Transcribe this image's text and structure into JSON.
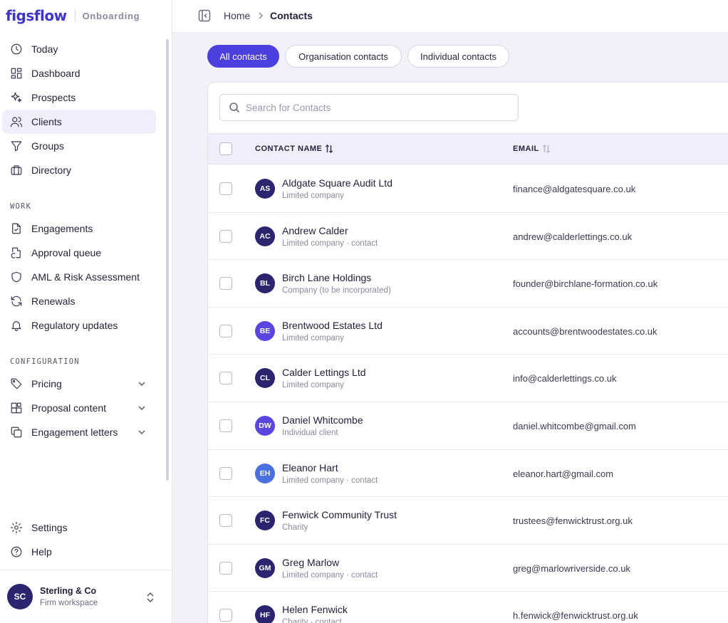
{
  "brand": {
    "logo": "figsflow",
    "workspace_label": "Onboarding"
  },
  "sidebar": {
    "top_items": [
      {
        "label": "Today",
        "icon": "clock-icon"
      },
      {
        "label": "Dashboard",
        "icon": "grid-icon"
      },
      {
        "label": "Prospects",
        "icon": "sparkle-icon"
      },
      {
        "label": "Clients",
        "icon": "users-icon",
        "active": true
      },
      {
        "label": "Groups",
        "icon": "filter-icon"
      },
      {
        "label": "Directory",
        "icon": "briefcase-icon"
      }
    ],
    "work_label": "WORK",
    "work_items": [
      {
        "label": "Engagements",
        "icon": "file-check-icon"
      },
      {
        "label": "Approval queue",
        "icon": "file-refresh-icon"
      },
      {
        "label": "AML & Risk Assessment",
        "icon": "shield-icon"
      },
      {
        "label": "Renewals",
        "icon": "refresh-icon"
      },
      {
        "label": "Regulatory updates",
        "icon": "bell-icon"
      }
    ],
    "config_label": "CONFIGURATION",
    "config_items": [
      {
        "label": "Pricing",
        "icon": "tag-icon"
      },
      {
        "label": "Proposal content",
        "icon": "blocks-icon"
      },
      {
        "label": "Engagement letters",
        "icon": "copy-icon"
      }
    ],
    "bottom_items": [
      {
        "label": "Settings",
        "icon": "gear-icon"
      },
      {
        "label": "Help",
        "icon": "help-icon"
      }
    ],
    "workspace": {
      "initials": "SC",
      "name": "Sterling & Co",
      "sub": "Firm workspace"
    }
  },
  "breadcrumb": {
    "home": "Home",
    "current": "Contacts"
  },
  "tabs": [
    {
      "label": "All contacts",
      "active": true
    },
    {
      "label": "Organisation contacts",
      "active": false
    },
    {
      "label": "Individual contacts",
      "active": false
    }
  ],
  "search": {
    "placeholder": "Search for Contacts",
    "value": ""
  },
  "table": {
    "columns": {
      "name": "CONTACT NAME",
      "email": "EMAIL"
    },
    "rows": [
      {
        "initials": "AS",
        "name": "Aldgate Square Audit Ltd",
        "type": "Limited company",
        "email": "finance@aldgatesquare.co.uk",
        "color": "#2b2570"
      },
      {
        "initials": "AC",
        "name": "Andrew Calder",
        "type": "Limited company · contact",
        "email": "andrew@calderlettings.co.uk",
        "color": "#2b2570"
      },
      {
        "initials": "BL",
        "name": "Birch Lane Holdings",
        "type": "Company (to be incorporated)",
        "email": "founder@birchlane-formation.co.uk",
        "color": "#2b2570"
      },
      {
        "initials": "BE",
        "name": "Brentwood Estates Ltd",
        "type": "Limited company",
        "email": "accounts@brentwoodestates.co.uk",
        "color": "#5a45e0"
      },
      {
        "initials": "CL",
        "name": "Calder Lettings Ltd",
        "type": "Limited company",
        "email": "info@calderlettings.co.uk",
        "color": "#2b2570"
      },
      {
        "initials": "DW",
        "name": "Daniel Whitcombe",
        "type": "Individual client",
        "email": "daniel.whitcombe@gmail.com",
        "color": "#5a45e0"
      },
      {
        "initials": "EH",
        "name": "Eleanor Hart",
        "type": "Limited company · contact",
        "email": "eleanor.hart@gmail.com",
        "color": "#4a6fe0"
      },
      {
        "initials": "FC",
        "name": "Fenwick Community Trust",
        "type": "Charity",
        "email": "trustees@fenwicktrust.org.uk",
        "color": "#2b2570"
      },
      {
        "initials": "GM",
        "name": "Greg Marlow",
        "type": "Limited company · contact",
        "email": "greg@marlowriverside.co.uk",
        "color": "#2b2570"
      },
      {
        "initials": "HF",
        "name": "Helen Fenwick",
        "type": "Charity · contact",
        "email": "h.fenwick@fenwicktrust.org.uk",
        "color": "#2b2570"
      }
    ]
  },
  "colors": {
    "accent": "#4c3fe0",
    "sidebar_active": "#efeefa",
    "header_bg": "#efeefa"
  }
}
